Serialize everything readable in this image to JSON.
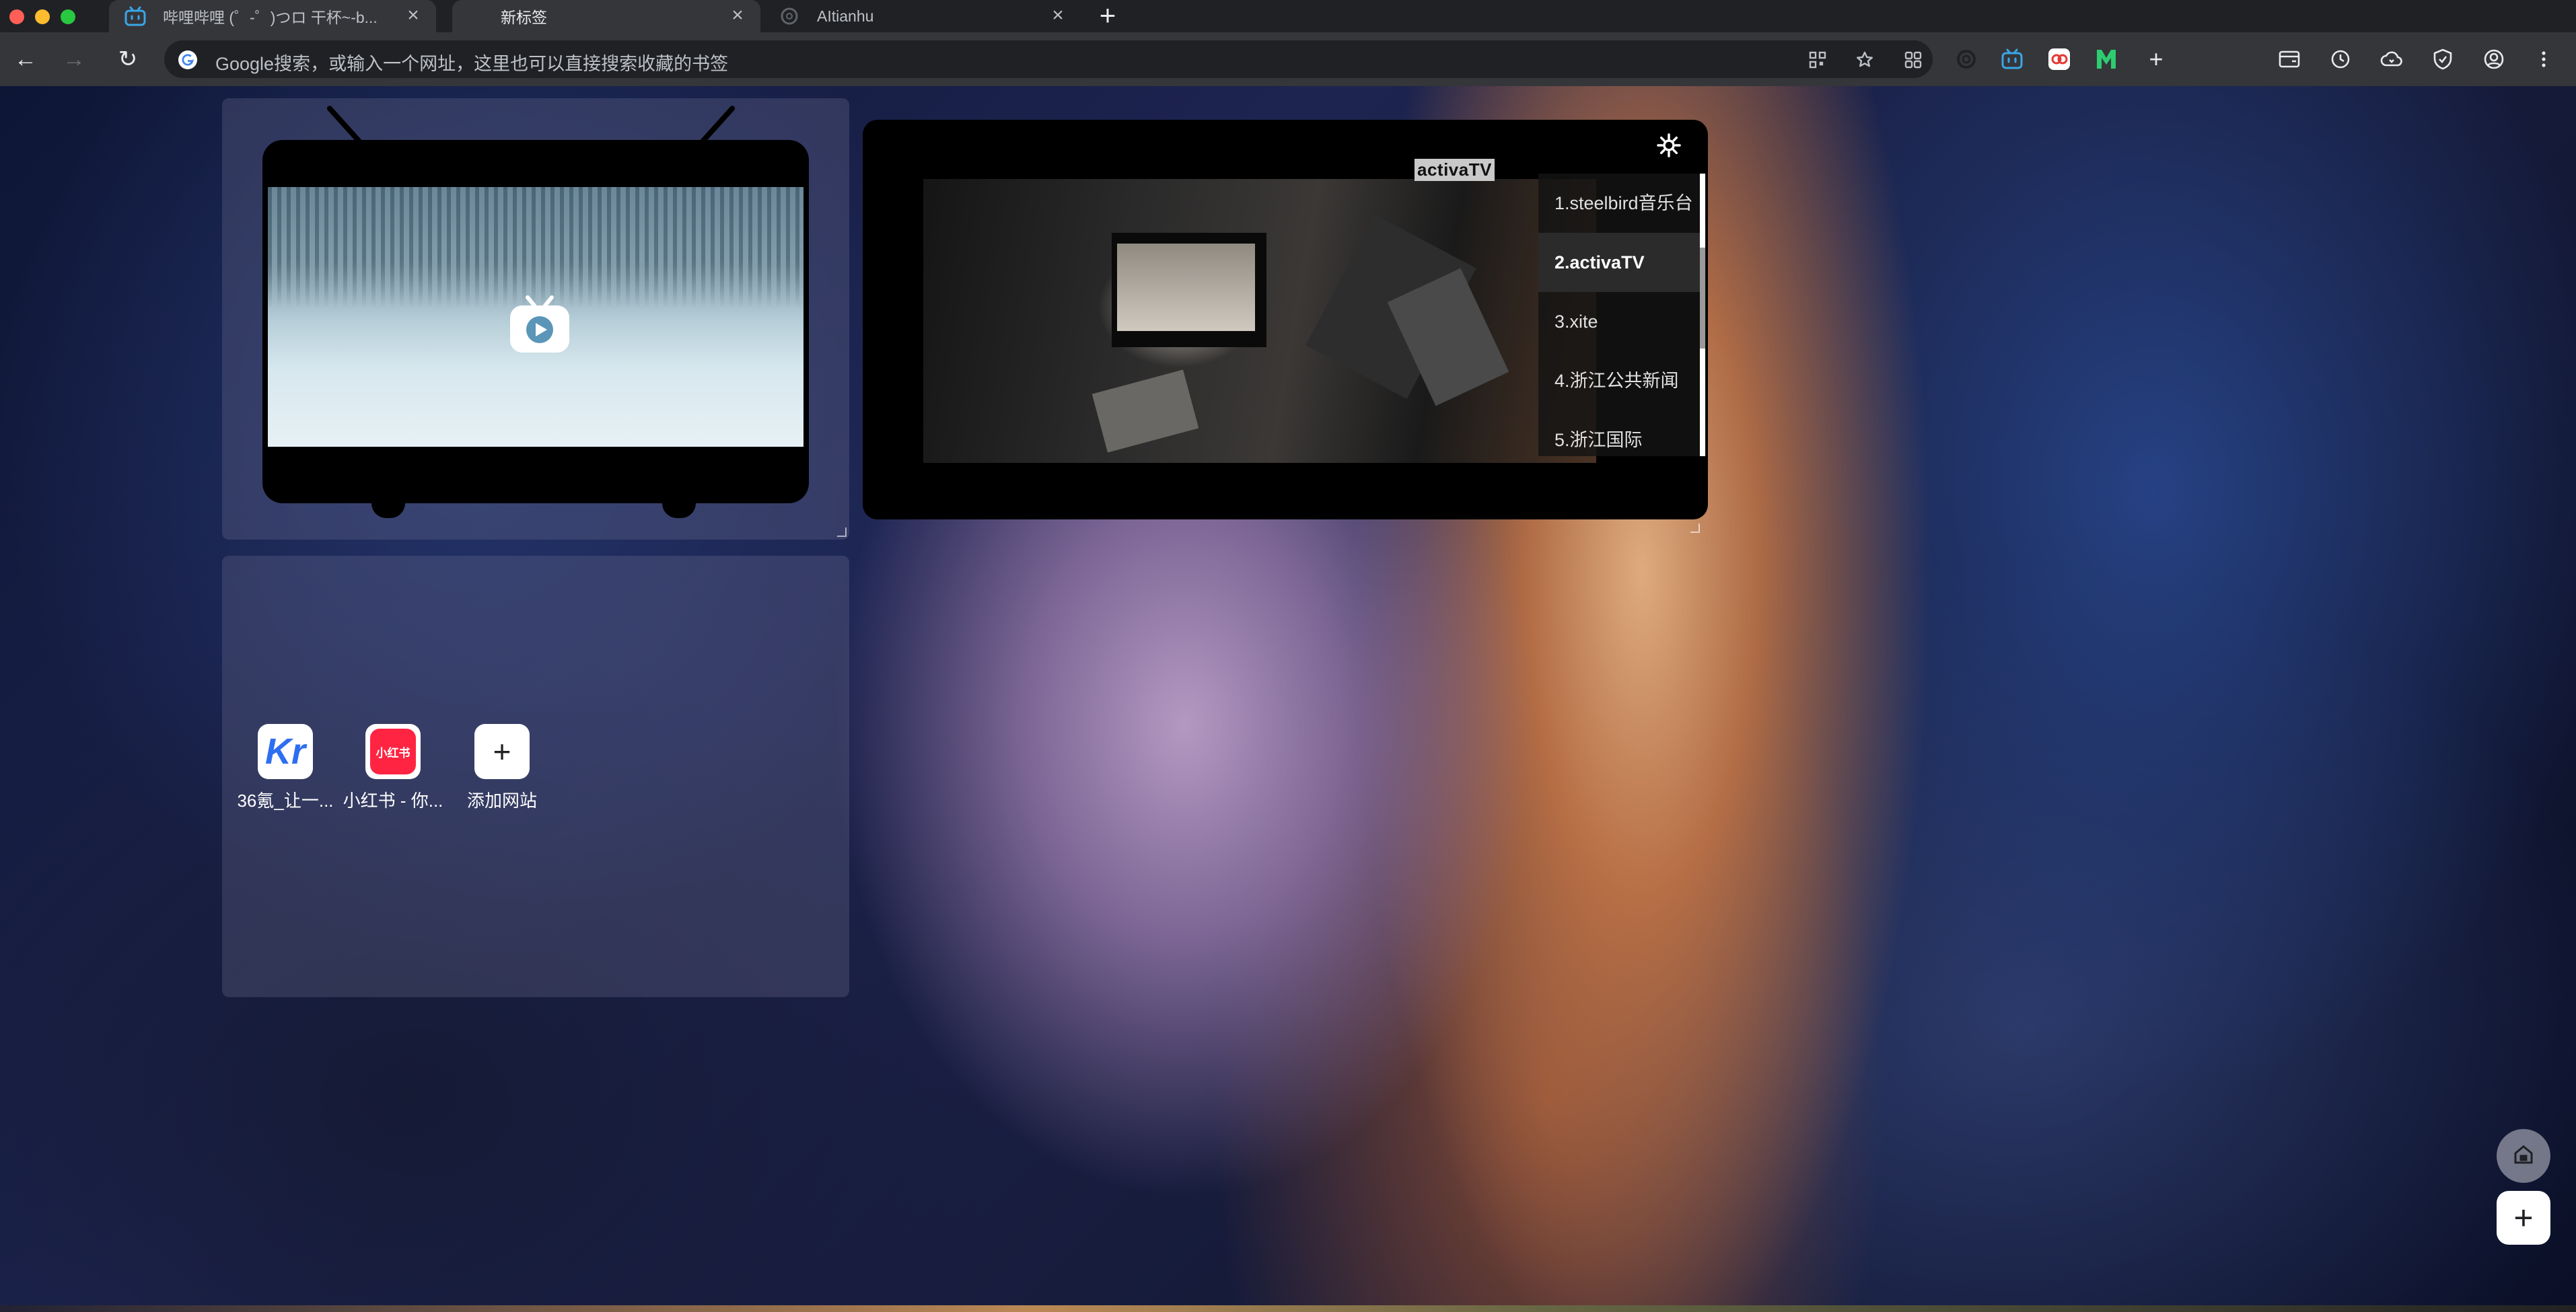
{
  "browser": {
    "tabs": [
      {
        "title": "哔哩哔哩 (゜-゜)つロ 干杯~-b...",
        "icon": "bilibili-icon",
        "active": false
      },
      {
        "title": "新标签",
        "icon": "",
        "active": true
      },
      {
        "title": "AItianhu",
        "icon": "openai-icon",
        "active": false
      }
    ],
    "new_tab_symbol": "+",
    "address_bar": {
      "placeholder": "Google搜索，或输入一个网址，这里也可以直接搜索收藏的书签",
      "value": ""
    },
    "nav": {
      "back": "←",
      "forward": "→",
      "reload": "↻"
    },
    "extensions": [
      "openai-icon",
      "bilibili-icon",
      "redirect-icon",
      "m-green-icon",
      "add-extension-icon"
    ],
    "toolbar_icons": [
      "reading-list-icon",
      "history-icon",
      "cloud-download-icon",
      "shield-icon",
      "profile-icon",
      "menu-icon"
    ],
    "accent_color": "#1a73e8"
  },
  "page": {
    "tv_widget": {
      "play_icon": "bilibili-tv-icon"
    },
    "channel_widget": {
      "logo_text": "activaTV",
      "channels": [
        {
          "label": "1.steelbird音乐台",
          "active": false
        },
        {
          "label": "2.activaTV",
          "active": true
        },
        {
          "label": "3.xite",
          "active": false
        },
        {
          "label": "4.浙江公共新闻",
          "active": false
        },
        {
          "label": "5.浙江国际",
          "active": false
        }
      ],
      "settings_icon": "gear-icon"
    },
    "shortcuts": [
      {
        "label": "36氪_让一...",
        "icon": "36kr-icon",
        "icon_text": "Kr",
        "color": "#2e6ff0"
      },
      {
        "label": "小红书 - 你...",
        "icon": "xiaohongshu-icon",
        "icon_text": "小红书",
        "color": "#ff2442"
      },
      {
        "label": "添加网站",
        "icon": "plus-icon",
        "icon_text": "+",
        "color": "#222222"
      }
    ],
    "fab": {
      "home_icon": "home-icon",
      "add_icon": "plus-icon",
      "add_symbol": "+"
    }
  }
}
